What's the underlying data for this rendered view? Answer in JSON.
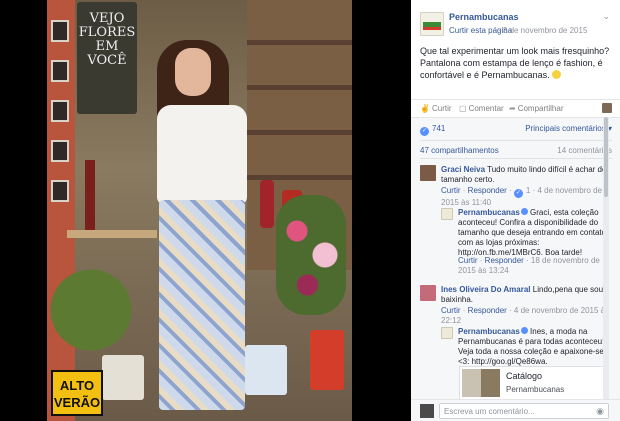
{
  "badge": {
    "line1": "ALTO",
    "line2": "VERÃO"
  },
  "chalkboard": {
    "lines": [
      "VEJO",
      "FLORES",
      "EM",
      "VOCÊ"
    ]
  },
  "post": {
    "page_name": "Pernambucanas",
    "like_page": "Curtir esta página",
    "date": "3 de novembro de 2015",
    "text": "Que tal experimentar um look mais fresquinho? Pantalona com estampa de lenço é fashion, é confortável e é Pernambucanas."
  },
  "actions": {
    "like": "Curtir",
    "comment": "Comentar",
    "share": "Compartilhar"
  },
  "stats": {
    "reactions": "741",
    "filter": "Principais comentários",
    "shares": "47 compartilhamentos",
    "comments": "14 comentários"
  },
  "comments": [
    {
      "author": "Graci Neiva",
      "text": "Tudo muito lindo difícil é achar do tamanho certo.",
      "like": "Curtir",
      "reply": "Responder",
      "likes": "1",
      "date": "4 de novembro de 2015 às 11:40"
    },
    {
      "author": "Pernambucanas",
      "text": "Graci, esta coleção aconteceu! Confira a disponibilidade do tamanho que deseja entrando em contato com as lojas próximas: http://on.fb.me/1MBrC6. Boa tarde!",
      "like": "Curtir",
      "reply": "Responder",
      "date": "18 de novembro de 2015 às 13:24"
    },
    {
      "author": "Ines Oliveira Do Amaral",
      "text": "Lindo,pena que sou baixinha.",
      "like": "Curtir",
      "reply": "Responder",
      "date": "4 de novembro de 2015 às 22:12"
    },
    {
      "author": "Pernambucanas",
      "text": "Ines, a moda na Pernambucanas é para todas aconteceu!!! Veja toda a nossa coleção e apaixone-se <3: http://goo.gl/Qe86wa.",
      "catalog_title": "Catálogo",
      "catalog_source": "Pernambucanas"
    }
  ],
  "composer": {
    "placeholder": "Escreva um comentário..."
  }
}
